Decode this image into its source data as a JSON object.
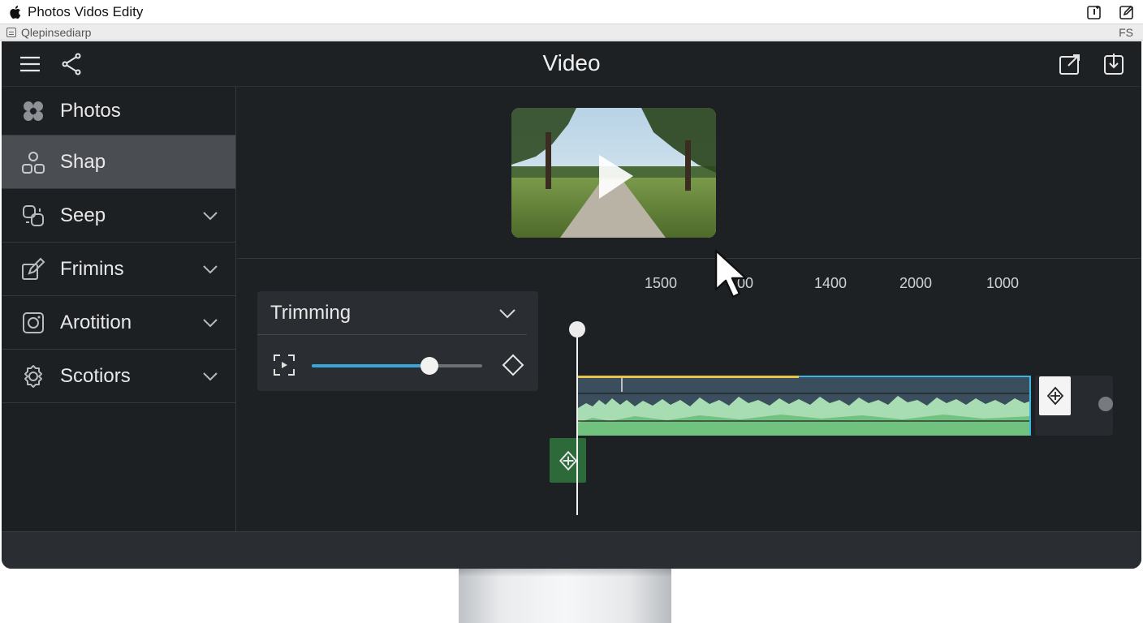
{
  "menubar": {
    "app_name": "Photos Vidos Edity",
    "icons": [
      "apple-logo",
      "window-icon",
      "edit-icon"
    ]
  },
  "subbar": {
    "label": "Qlepinsediarp",
    "right_label": "FS"
  },
  "toolbar": {
    "title": "Video",
    "icons": [
      "hamburger-menu-icon",
      "share-icon",
      "export-icon",
      "download-icon"
    ]
  },
  "sidebar": {
    "items": [
      {
        "label": "Photos",
        "icon": "photos-icon",
        "expandable": false,
        "active": false
      },
      {
        "label": "Shap",
        "icon": "people-icon",
        "expandable": false,
        "active": true
      },
      {
        "label": "Seep",
        "icon": "link-icon",
        "expandable": true,
        "active": false
      },
      {
        "label": "Frimins",
        "icon": "edit-pencil-icon",
        "expandable": true,
        "active": false
      },
      {
        "label": "Arotition",
        "icon": "camera-icon",
        "expandable": true,
        "active": false
      },
      {
        "label": "Scotiors",
        "icon": "gear-icon",
        "expandable": true,
        "active": false
      }
    ]
  },
  "preview": {
    "icon": "play-icon"
  },
  "trim_panel": {
    "title": "Trimming",
    "slider_value": 0.69,
    "accent_color": "#3aa6d8"
  },
  "timeline": {
    "ruler_labels": [
      "1500",
      "00",
      "1400",
      "2000",
      "1000"
    ],
    "selection_color": "#38b6e4",
    "marker_color": "#e7c44a",
    "waveform_color": "#8fd39a"
  }
}
